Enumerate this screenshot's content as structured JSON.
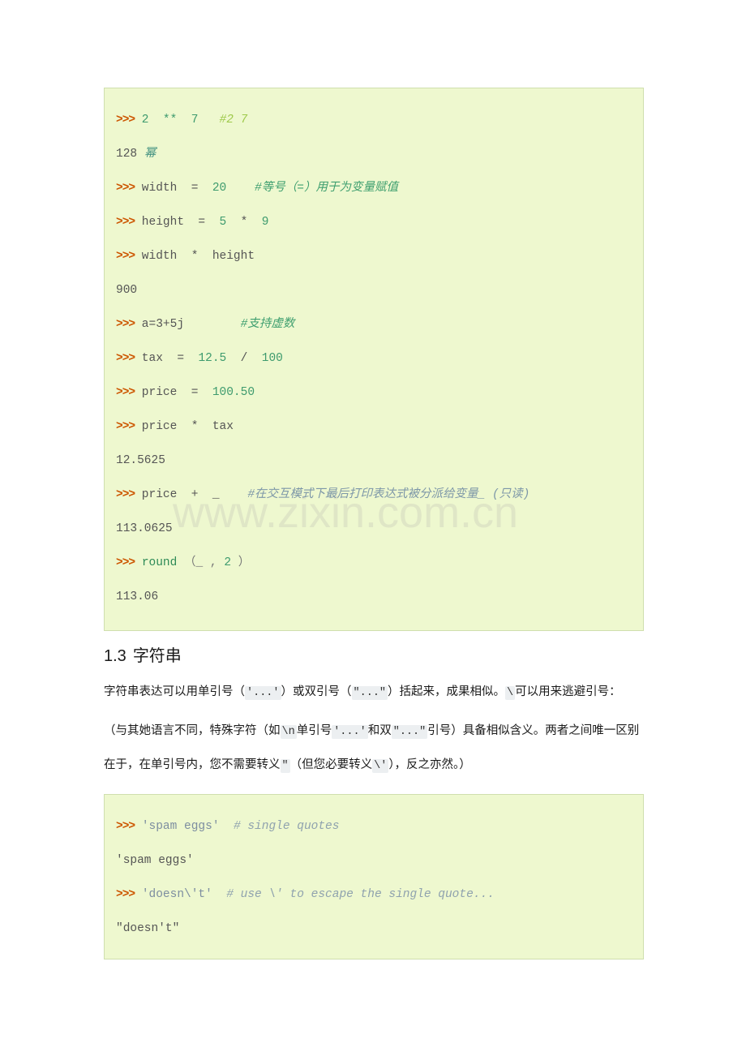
{
  "document": {
    "watermark": "www.zixin.com.cn",
    "code_block_1": {
      "lines": [
        {
          "prompt": ">>>",
          "segments": [
            {
              "text": " 2  ** ",
              "cls": "num"
            },
            {
              "text": " 7",
              "cls": "num"
            },
            {
              "text": "   ",
              "cls": "plain"
            },
            {
              "text": "#2 7",
              "cls": "cmt-green"
            }
          ]
        },
        {
          "prompt": "",
          "segments": [
            {
              "text": "128 ",
              "cls": "plain"
            },
            {
              "text": "幂",
              "cls": "cn-italic"
            }
          ]
        },
        {
          "prompt": ">>>",
          "segments": [
            {
              "text": " width  =  ",
              "cls": "plain"
            },
            {
              "text": "20",
              "cls": "num"
            },
            {
              "text": "    ",
              "cls": "plain"
            },
            {
              "text": "#等号（=）用于为变量赋值",
              "cls": "cmt-cn"
            }
          ]
        },
        {
          "prompt": ">>>",
          "segments": [
            {
              "text": " height  =  ",
              "cls": "plain"
            },
            {
              "text": "5",
              "cls": "num"
            },
            {
              "text": "  *  ",
              "cls": "plain"
            },
            {
              "text": "9",
              "cls": "num"
            }
          ]
        },
        {
          "prompt": ">>>",
          "segments": [
            {
              "text": " width  *  height",
              "cls": "plain"
            }
          ]
        },
        {
          "prompt": "",
          "segments": [
            {
              "text": "900",
              "cls": "plain"
            }
          ]
        },
        {
          "prompt": ">>>",
          "segments": [
            {
              "text": " a=3+5j",
              "cls": "plain"
            },
            {
              "text": "        ",
              "cls": "plain"
            },
            {
              "text": "#支持虚数",
              "cls": "cmt-cn"
            }
          ]
        },
        {
          "prompt": ">>>",
          "segments": [
            {
              "text": " tax  =  ",
              "cls": "plain"
            },
            {
              "text": "12.5",
              "cls": "num"
            },
            {
              "text": "  /  ",
              "cls": "plain"
            },
            {
              "text": "100",
              "cls": "num"
            }
          ]
        },
        {
          "prompt": ">>>",
          "segments": [
            {
              "text": " price  =  ",
              "cls": "plain"
            },
            {
              "text": "100.50",
              "cls": "num"
            }
          ]
        },
        {
          "prompt": ">>>",
          "segments": [
            {
              "text": " price  *  tax",
              "cls": "plain"
            }
          ]
        },
        {
          "prompt": "",
          "segments": [
            {
              "text": "12.5625",
              "cls": "plain"
            }
          ]
        },
        {
          "prompt": ">>>",
          "segments": [
            {
              "text": " price  +  _ ",
              "cls": "plain"
            },
            {
              "text": "   ",
              "cls": "plain"
            },
            {
              "text": "#在交互模式下最后打印表达式被分派给变量_ (只读)",
              "cls": "cmt-blue"
            }
          ]
        },
        {
          "prompt": "",
          "segments": [
            {
              "text": "113.0625",
              "cls": "plain"
            }
          ]
        },
        {
          "prompt": ">>>",
          "segments": [
            {
              "text": " ",
              "cls": "plain"
            },
            {
              "text": "round",
              "cls": "kw"
            },
            {
              "text": " （_ , ",
              "cls": "punct"
            },
            {
              "text": "2",
              "cls": "num"
            },
            {
              "text": " ）",
              "cls": "punct"
            }
          ]
        },
        {
          "prompt": "",
          "segments": [
            {
              "text": "113.06",
              "cls": "plain"
            }
          ]
        }
      ]
    },
    "heading": {
      "number": "1.3",
      "title": "字符串"
    },
    "paragraph_1": {
      "part_1": "字符串表达可以用单引号（",
      "code_1": "'...'",
      "part_2": "）或双引号（",
      "code_2": "\"...\"",
      "part_3": "）括起来，成果相似。",
      "code_3": "\\",
      "part_4": "可以用来逃避引号："
    },
    "paragraph_2": {
      "part_1": "（与其她语言不同，特殊字符（如",
      "code_1": "\\n",
      "part_2": "单引号",
      "code_2": "'...'",
      "part_3": "和双",
      "code_3": "\"...\"",
      "part_4": "引号）具备相似含义。两者之间唯一区别在于，在单引号内，您不需要转义",
      "code_4": "\"",
      "part_5": "（但您必要转义",
      "code_5": "\\'",
      "part_6": "），反之亦然。）"
    },
    "code_block_2": {
      "lines": [
        {
          "prompt": ">>>",
          "segments": [
            {
              "text": " ",
              "cls": "plain"
            },
            {
              "text": "'spam eggs'",
              "cls": "str"
            },
            {
              "text": "  ",
              "cls": "plain"
            },
            {
              "text": "# single quotes",
              "cls": "cmt-gray"
            }
          ]
        },
        {
          "prompt": "",
          "segments": [
            {
              "text": "'spam eggs'",
              "cls": "plain"
            }
          ]
        },
        {
          "prompt": ">>>",
          "segments": [
            {
              "text": " ",
              "cls": "plain"
            },
            {
              "text": "'doesn\\'t'",
              "cls": "str"
            },
            {
              "text": "  ",
              "cls": "plain"
            },
            {
              "text": "# use \\' to escape the single quote...",
              "cls": "cmt-gray"
            }
          ]
        },
        {
          "prompt": "",
          "segments": [
            {
              "text": "\"doesn't\"",
              "cls": "plain"
            }
          ]
        }
      ]
    }
  }
}
